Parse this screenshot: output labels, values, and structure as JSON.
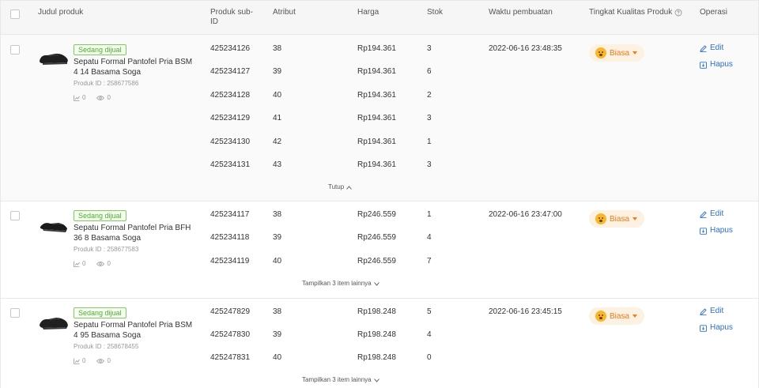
{
  "header": {
    "title": "Judul produk",
    "subid": "Produk sub-ID",
    "attr": "Atribut",
    "price": "Harga",
    "stock": "Stok",
    "created": "Waktu pembuatan",
    "quality": "Tingkat Kualitas Produk",
    "ops": "Operasi"
  },
  "products": [
    {
      "status": "Sedang dijual",
      "title": "Sepatu Formal Pantofel Pria BSM 4 14 Basama Soga",
      "product_id": "Produk ID :  258677586",
      "sales": "0",
      "views": "0",
      "created": "2022-06-16 23:48:35",
      "quality": "Biasa",
      "edit": "Edit",
      "delete": "Hapus",
      "toggle": "Tutup",
      "rows": [
        {
          "subid": "425234126",
          "attr": "38",
          "price": "Rp194.361",
          "stock": "3"
        },
        {
          "subid": "425234127",
          "attr": "39",
          "price": "Rp194.361",
          "stock": "6"
        },
        {
          "subid": "425234128",
          "attr": "40",
          "price": "Rp194.361",
          "stock": "2"
        },
        {
          "subid": "425234129",
          "attr": "41",
          "price": "Rp194.361",
          "stock": "3"
        },
        {
          "subid": "425234130",
          "attr": "42",
          "price": "Rp194.361",
          "stock": "1"
        },
        {
          "subid": "425234131",
          "attr": "43",
          "price": "Rp194.361",
          "stock": "3"
        }
      ]
    },
    {
      "status": "Sedang dijual",
      "title": "Sepatu Formal Pantofel Pria BFH 36 8 Basama Soga",
      "product_id": "Produk ID :  258677583",
      "sales": "0",
      "views": "0",
      "created": "2022-06-16 23:47:00",
      "quality": "Biasa",
      "edit": "Edit",
      "delete": "Hapus",
      "toggle": "Tampilkan 3 item lainnya",
      "rows": [
        {
          "subid": "425234117",
          "attr": "38",
          "price": "Rp246.559",
          "stock": "1"
        },
        {
          "subid": "425234118",
          "attr": "39",
          "price": "Rp246.559",
          "stock": "4"
        },
        {
          "subid": "425234119",
          "attr": "40",
          "price": "Rp246.559",
          "stock": "7"
        }
      ]
    },
    {
      "status": "Sedang dijual",
      "title": "Sepatu Formal Pantofel Pria BSM 4 95 Basama Soga",
      "product_id": "Produk ID :  258678455",
      "sales": "0",
      "views": "0",
      "created": "2022-06-16 23:45:15",
      "quality": "Biasa",
      "edit": "Edit",
      "delete": "Hapus",
      "toggle": "Tampilkan 3 item lainnya",
      "rows": [
        {
          "subid": "425247829",
          "attr": "38",
          "price": "Rp198.248",
          "stock": "5"
        },
        {
          "subid": "425247830",
          "attr": "39",
          "price": "Rp198.248",
          "stock": "4"
        },
        {
          "subid": "425247831",
          "attr": "40",
          "price": "Rp198.248",
          "stock": "0"
        }
      ]
    }
  ]
}
